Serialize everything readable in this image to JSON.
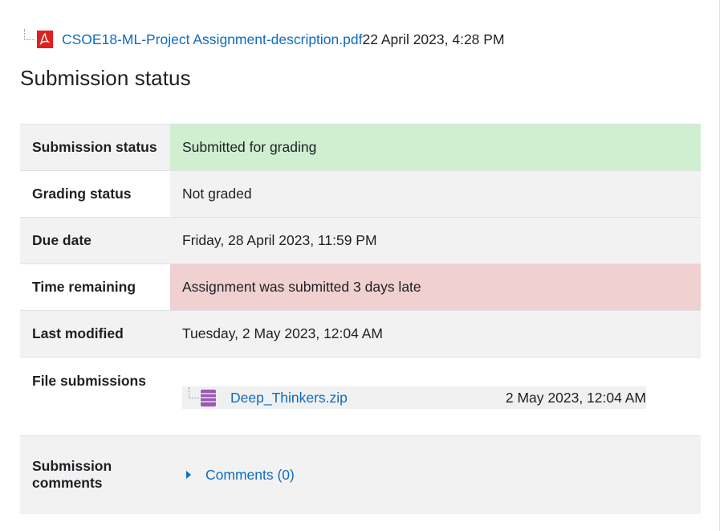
{
  "attachment": {
    "filename": "CSOE18-ML-Project Assignment-description.pdf",
    "date": "22 April 2023, 4:28 PM",
    "icon": "pdf-icon"
  },
  "heading": "Submission status",
  "rows": {
    "submission_status": {
      "label": "Submission status",
      "value": "Submitted for grading"
    },
    "grading_status": {
      "label": "Grading status",
      "value": "Not graded"
    },
    "due_date": {
      "label": "Due date",
      "value": "Friday, 28 April 2023, 11:59 PM"
    },
    "time_remaining": {
      "label": "Time remaining",
      "value": "Assignment was submitted 3 days late"
    },
    "last_modified": {
      "label": "Last modified",
      "value": "Tuesday, 2 May 2023, 12:04 AM"
    },
    "file_submissions": {
      "label": "File submissions",
      "file": {
        "name": "Deep_Thinkers.zip",
        "date": "2 May 2023, 12:04 AM",
        "icon": "zip-icon"
      }
    },
    "submission_comments": {
      "label": "Submission comments",
      "link": "Comments (0)"
    }
  },
  "colors": {
    "link": "#0f6cbf",
    "success_bg": "#cfefd0",
    "danger_bg": "#f0d0d1",
    "stripe_bg": "#f2f2f2"
  }
}
